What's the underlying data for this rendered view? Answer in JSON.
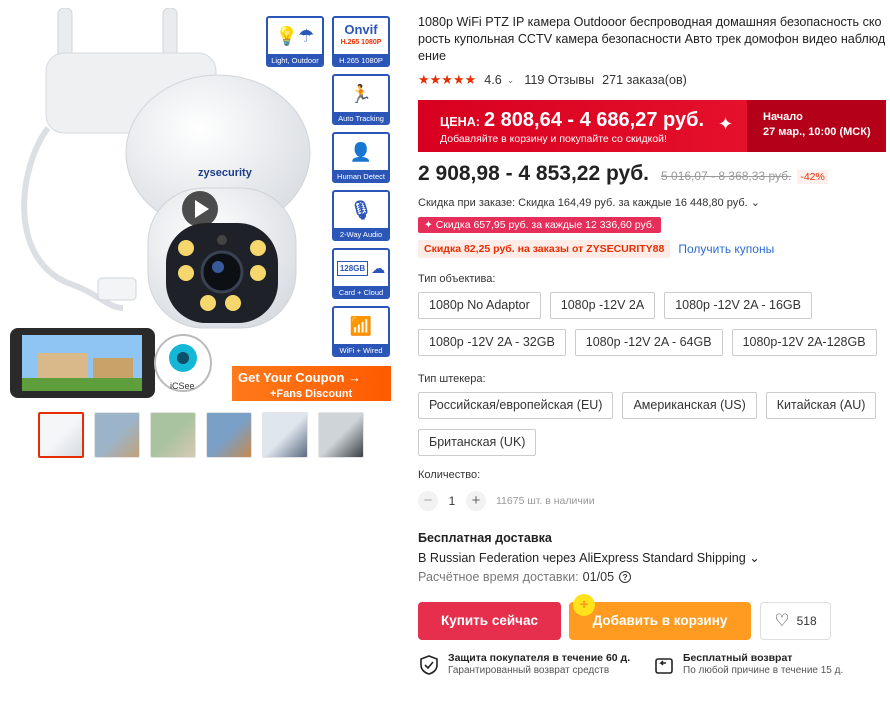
{
  "product": {
    "title": "1080p WiFi PTZ IP камера Outdooor беспроводная домашняя безопасность скорость купольная CCTV камера безопасности Авто трек домофон видео наблюдение",
    "stars": "★★★★★",
    "rating": "4.6",
    "reviews": "119 Отзывы",
    "orders": "271 заказа(ов)"
  },
  "gallery": {
    "brand": "zysecurity",
    "features": [
      {
        "label": "Light, Outdoor",
        "icon": "bulb-umbrella-icon"
      },
      {
        "label": "H.265 1080P",
        "icon": "onvif-icon",
        "top1": "Onvif",
        "top2": "H.265 1080P"
      },
      {
        "label": "Auto Tracking",
        "icon": "auto-tracking-icon"
      },
      {
        "label": "Human Detect",
        "icon": "human-detect-icon"
      },
      {
        "label": "2-Way Audio",
        "icon": "two-way-audio-icon"
      },
      {
        "label": "Card + Cloud",
        "icon": "card-cloud-icon",
        "card": "128GB"
      },
      {
        "label": "WiFi + Wired",
        "icon": "wifi-wired-icon"
      }
    ],
    "app": "iCSee",
    "coupon_line1": "Get Your Coupon →",
    "coupon_line2": "+Fans Discount",
    "thumb_count": 6
  },
  "promo": {
    "label": "ЦЕНА:",
    "range": "2 808,64 - 4 686,27 руб.",
    "sub": "Добавляйте в корзину и покупайте со скидкой!",
    "start_label": "Начало",
    "start_date": "27 мар., 10:00 (МСК)"
  },
  "price": {
    "current": "2 908,98 - 4 853,22 руб.",
    "old": "5 016,07 - 8 368,33 руб.",
    "discount": "-42%"
  },
  "savings": {
    "line": "Скидка при заказе: Скидка 164,49 руб. за каждые 16 448,80 руб. ⌄",
    "tag": "✦ Скидка 657,95 руб. за каждые 12 336,60 руб.",
    "coupon_tag": "Скидка 82,25 руб. на заказы от ZYSECURITY88",
    "coupon_link": "Получить купоны"
  },
  "lens": {
    "label": "Тип объектива:",
    "options": [
      "1080p No Adaptor",
      "1080p -12V 2A",
      "1080p -12V 2A - 16GB",
      "1080p -12V 2A - 32GB",
      "1080p -12V 2A - 64GB",
      "1080p-12V 2A-128GB"
    ]
  },
  "plug": {
    "label": "Тип штекера:",
    "options": [
      "Российская/европейская (EU)",
      "Американская (US)",
      "Китайская (AU)",
      "Британская (UK)"
    ]
  },
  "quantity": {
    "label": "Количество:",
    "minus": "−",
    "value": "1",
    "plus": "+",
    "stock": "11675 шт. в наличии"
  },
  "shipping": {
    "title": "Бесплатная доставка",
    "line": "В Russian Federation через AliExpress Standard Shipping ⌄",
    "est_label": "Расчётное время доставки:",
    "est_value": "01/05",
    "help": "?"
  },
  "actions": {
    "buy": "Купить сейчас",
    "cart": "Добавить в корзину",
    "cart_badge": "+",
    "wish_count": "518"
  },
  "guarantees": [
    {
      "title": "Защита покупателя в течение 60 д.",
      "sub": "Гарантированный возврат средств"
    },
    {
      "title": "Бесплатный возврат",
      "sub": "По любой причине в течение 15 д."
    }
  ],
  "colors": {
    "accent": "#e62e04",
    "buy": "#e62e4d",
    "cart": "#ff9b21",
    "promo": "#d8001f"
  }
}
